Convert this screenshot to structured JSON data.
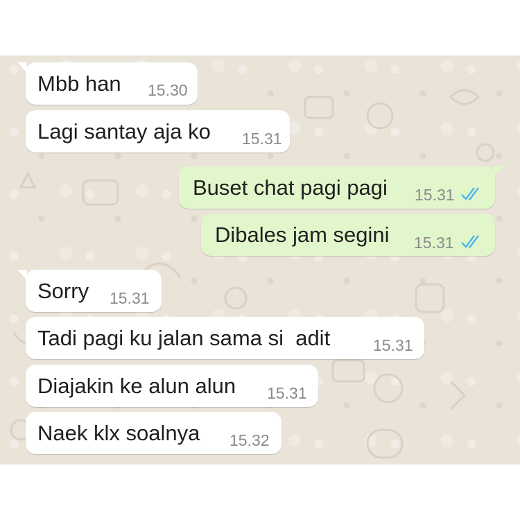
{
  "messages": [
    {
      "text": "Mbb han",
      "time": "15.30",
      "direction": "incoming"
    },
    {
      "text": "Lagi santay aja ko",
      "time": "15.31",
      "direction": "incoming"
    },
    {
      "text": "Buset chat pagi pagi",
      "time": "15.31",
      "direction": "outgoing",
      "status": "read"
    },
    {
      "text": "Dibales jam segini",
      "time": "15.31",
      "direction": "outgoing",
      "status": "read"
    },
    {
      "text": "Sorry",
      "time": "15.31",
      "direction": "incoming"
    },
    {
      "text": "Tadi pagi ku jalan sama si  adit",
      "time": "15.31",
      "direction": "incoming"
    },
    {
      "text": "Diajakin ke alun alun",
      "time": "15.31",
      "direction": "incoming"
    },
    {
      "text": "Naek klx soalnya",
      "time": "15.32",
      "direction": "incoming"
    }
  ],
  "colors": {
    "incoming_bubble": "#ffffff",
    "outgoing_bubble": "#e1f7cb",
    "chat_background": "#e9e3d8",
    "read_ticks": "#4fb6ec",
    "timestamp": "#8a8a8a"
  },
  "icons": {
    "read_status": "double-check-icon"
  }
}
